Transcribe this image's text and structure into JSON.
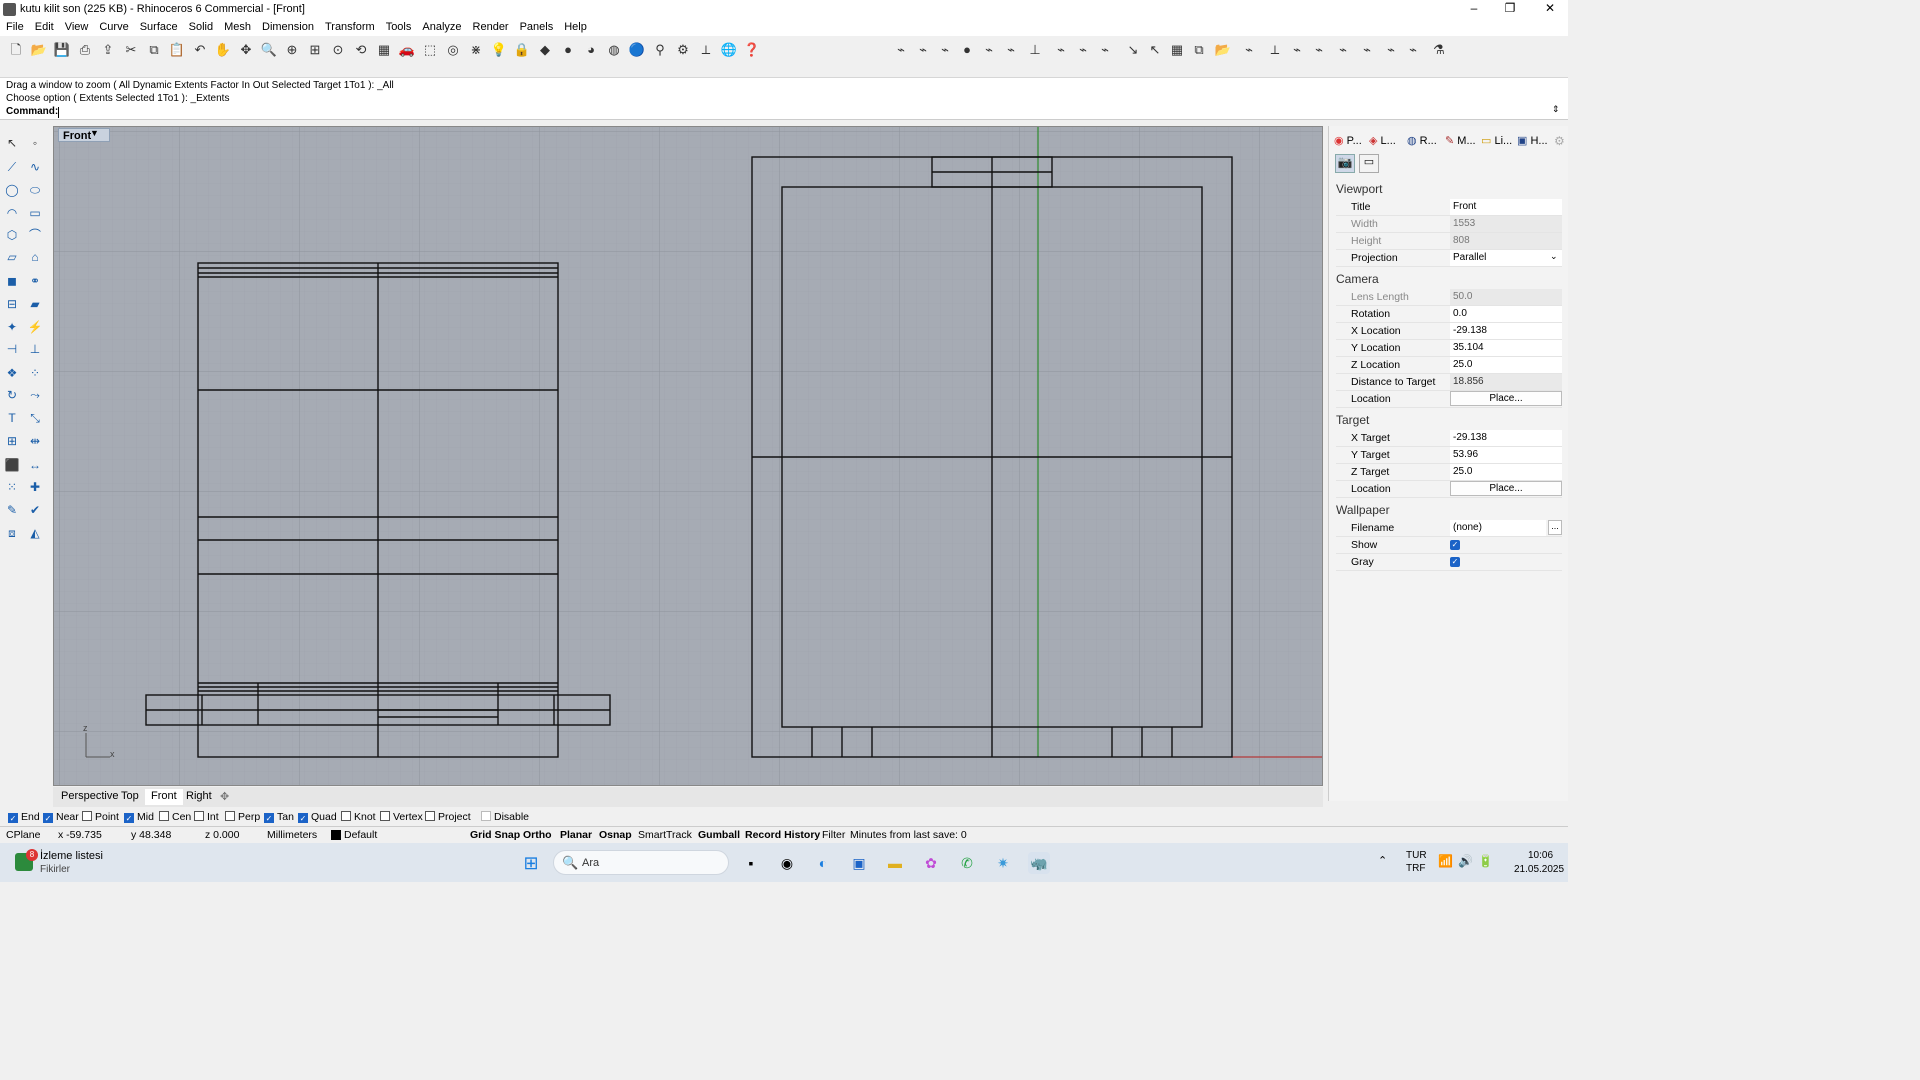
{
  "window": {
    "title": "kutu kilit son (225 KB) - Rhinoceros 6 Commercial - [Front]",
    "minimize": "–",
    "maximize": "❐",
    "close": "✕"
  },
  "menu": [
    "File",
    "Edit",
    "View",
    "Curve",
    "Surface",
    "Solid",
    "Mesh",
    "Dimension",
    "Transform",
    "Tools",
    "Analyze",
    "Render",
    "Panels",
    "Help"
  ],
  "command": {
    "history_1": "Drag a window to zoom ( All  Dynamic  Extents  Factor  In  Out  Selected  Target  1To1 ): _All",
    "history_2": "Choose option ( Extents  Selected  1To1 ): _Extents",
    "prompt": "Command:"
  },
  "viewport": {
    "active_title": "Front",
    "axis_z": "z",
    "axis_x": "x"
  },
  "viewport_tabs": [
    "Perspective",
    "Top",
    "Front",
    "Right"
  ],
  "viewport_tab_add": "✥",
  "panel": {
    "tabs": [
      "P...",
      "L...",
      "R...",
      "M...",
      "Li...",
      "H..."
    ],
    "sections": {
      "viewport": "Viewport",
      "camera": "Camera",
      "target": "Target",
      "wallpaper": "Wallpaper"
    },
    "viewport_rows": [
      {
        "label": "Title",
        "value": "Front"
      },
      {
        "label": "Width",
        "value": "1553"
      },
      {
        "label": "Height",
        "value": "808"
      },
      {
        "label": "Projection",
        "value": "Parallel"
      }
    ],
    "camera_rows": [
      {
        "label": "Lens Length",
        "value": "50.0"
      },
      {
        "label": "Rotation",
        "value": "0.0"
      },
      {
        "label": "X Location",
        "value": "-29.138"
      },
      {
        "label": "Y Location",
        "value": "35.104"
      },
      {
        "label": "Z Location",
        "value": "25.0"
      },
      {
        "label": "Distance to Target",
        "value": "18.856"
      },
      {
        "label": "Location",
        "value": "Place..."
      }
    ],
    "target_rows": [
      {
        "label": "X Target",
        "value": "-29.138"
      },
      {
        "label": "Y Target",
        "value": "53.96"
      },
      {
        "label": "Z Target",
        "value": "25.0"
      },
      {
        "label": "Location",
        "value": "Place..."
      }
    ],
    "wallpaper_rows": [
      {
        "label": "Filename",
        "value": "(none)"
      },
      {
        "label": "Show",
        "value": ""
      },
      {
        "label": "Gray",
        "value": ""
      }
    ],
    "ellipsis": "..."
  },
  "osnap": [
    {
      "label": "End",
      "checked": true
    },
    {
      "label": "Near",
      "checked": true
    },
    {
      "label": "Point",
      "checked": false
    },
    {
      "label": "Mid",
      "checked": true
    },
    {
      "label": "Cen",
      "checked": false
    },
    {
      "label": "Int",
      "checked": false
    },
    {
      "label": "Perp",
      "checked": false
    },
    {
      "label": "Tan",
      "checked": true
    },
    {
      "label": "Quad",
      "checked": true
    },
    {
      "label": "Knot",
      "checked": false
    },
    {
      "label": "Vertex",
      "checked": false
    },
    {
      "label": "Project",
      "checked": false
    },
    {
      "label": "Disable",
      "checked": false
    }
  ],
  "status": {
    "cplane": "CPlane",
    "x": "x -59.735",
    "y": "y 48.348",
    "z": "z 0.000",
    "units": "Millimeters",
    "layer": "Default",
    "grid_snap": "Grid Snap",
    "ortho": "Ortho",
    "planar": "Planar",
    "osnap": "Osnap",
    "smarttrack": "SmartTrack",
    "gumball": "Gumball",
    "record_history": "Record History",
    "filter": "Filter",
    "last_save": "Minutes from last save: 0"
  },
  "taskbar": {
    "news_badge": "8",
    "news_title": "İzleme listesi",
    "news_sub": "Fikirler",
    "search_placeholder": "Ara",
    "lang_1": "TUR",
    "lang_2": "TRF",
    "time": "10:06",
    "date": "21.05.2025"
  },
  "colors": {
    "viewport_bg": "#a6abb4",
    "grid": "#9ba0a8",
    "accent": "#1b63c7",
    "y_axis": "#2e8b2e",
    "x_axis": "#b33a3a"
  }
}
